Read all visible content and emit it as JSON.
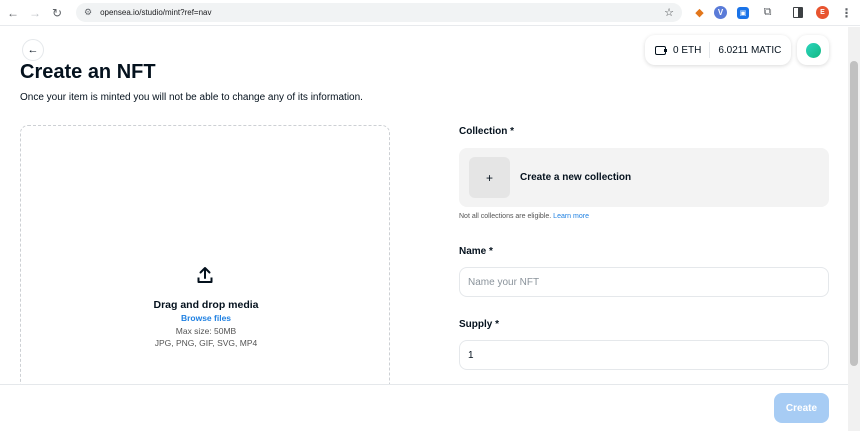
{
  "browser": {
    "url": "opensea.io/studio/mint?ref=nav",
    "profile_initial": "E"
  },
  "wallet": {
    "eth": "0 ETH",
    "matic": "6.0211 MATIC"
  },
  "page": {
    "title": "Create an NFT",
    "subtitle": "Once your item is minted you will not be able to change any of its information."
  },
  "dropzone": {
    "title": "Drag and drop media",
    "browse": "Browse files",
    "max_size": "Max size: 50MB",
    "types": "JPG, PNG, GIF, SVG, MP4"
  },
  "form": {
    "collection_label": "Collection *",
    "create_collection": "Create a new collection",
    "collection_hint": "Not all collections are eligible.",
    "learn_more": "Learn more",
    "name_label": "Name *",
    "name_placeholder": "Name your NFT",
    "supply_label": "Supply *",
    "supply_value": "1"
  },
  "footer": {
    "create_label": "Create"
  },
  "colors": {
    "accent": "#2081e2",
    "create_disabled": "#a7ccf4"
  }
}
